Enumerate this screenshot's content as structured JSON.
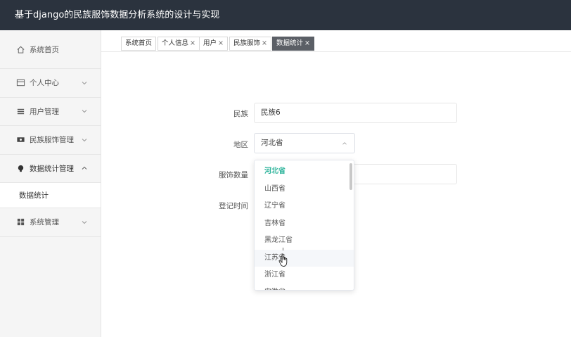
{
  "header": {
    "title": "基于django的民族服饰数据分析系统的设计与实现"
  },
  "sidebar": {
    "items": [
      {
        "label": "系统首页",
        "icon": "home-icon"
      },
      {
        "label": "个人中心",
        "icon": "card-icon"
      },
      {
        "label": "用户管理",
        "icon": "list-icon"
      },
      {
        "label": "民族服饰管理",
        "icon": "ticket-icon"
      },
      {
        "label": "数据统计管理",
        "icon": "bulb-icon"
      },
      {
        "label": "系统管理",
        "icon": "grid-icon"
      }
    ],
    "sub_item": "数据统计"
  },
  "tabs": [
    {
      "label": "系统首页",
      "close": ""
    },
    {
      "label": "个人信息",
      "close": "×"
    },
    {
      "label": "用户",
      "close": "×"
    },
    {
      "label": "民族服饰",
      "close": "×"
    },
    {
      "label": "数据统计",
      "close": "×"
    }
  ],
  "form": {
    "ethnic_label": "民族",
    "ethnic_value": "民族6",
    "region_label": "地区",
    "region_value": "河北省",
    "quantity_label": "服饰数量",
    "date_label": "登记时间"
  },
  "dropdown": {
    "options": [
      "河北省",
      "山西省",
      "辽宁省",
      "吉林省",
      "黑龙江省",
      "江苏省",
      "浙江省",
      "安徽省"
    ],
    "selected_index": 0,
    "hover_index": 5
  },
  "colors": {
    "header_bg": "#2b333e",
    "accent": "#2bb39a",
    "active_tab": "#5b5f66"
  }
}
